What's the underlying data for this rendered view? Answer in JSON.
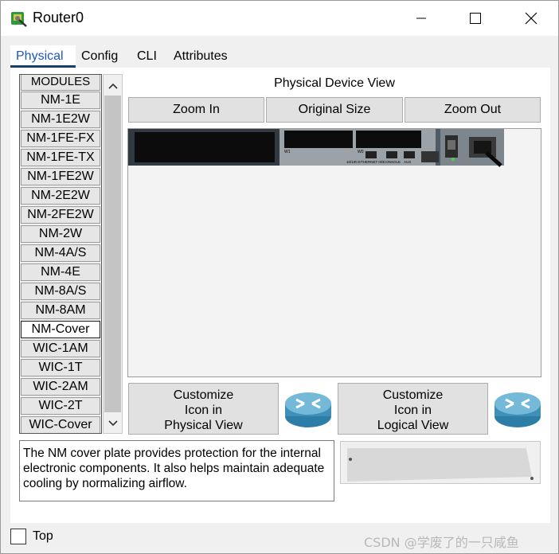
{
  "window": {
    "title": "Router0",
    "icon": "router-tool-icon"
  },
  "title_controls": {
    "minimize": "minimize-icon",
    "maximize": "maximize-icon",
    "close": "close-icon"
  },
  "tabs": [
    {
      "label": "Physical",
      "active": true
    },
    {
      "label": "Config",
      "active": false
    },
    {
      "label": "CLI",
      "active": false
    },
    {
      "label": "Attributes",
      "active": false
    }
  ],
  "modules": {
    "header": "MODULES",
    "items": [
      "NM-1E",
      "NM-1E2W",
      "NM-1FE-FX",
      "NM-1FE-TX",
      "NM-1FE2W",
      "NM-2E2W",
      "NM-2FE2W",
      "NM-2W",
      "NM-4A/S",
      "NM-4E",
      "NM-8A/S",
      "NM-8AM",
      "NM-Cover",
      "WIC-1AM",
      "WIC-1T",
      "WIC-2AM",
      "WIC-2T",
      "WIC-Cover"
    ],
    "selected": "NM-Cover"
  },
  "device_view": {
    "label": "Physical Device View",
    "zoom_in": "Zoom In",
    "original_size": "Original Size",
    "zoom_out": "Zoom Out",
    "port_labels": [
      "W1",
      "W0",
      "10/100",
      "ETHERNET 0/0",
      "CONSOLE",
      "AUX"
    ]
  },
  "customize": {
    "physical": [
      "Customize",
      "Icon in",
      "Physical View"
    ],
    "logical": [
      "Customize",
      "Icon in",
      "Logical View"
    ]
  },
  "description": "The NM cover plate provides protection for the internal electronic components. It also helps maintain adequate cooling by normalizing airflow.",
  "footer": {
    "top_checkbox_label": "Top",
    "top_checked": false,
    "watermark": "CSDN @学废了的一只咸鱼"
  },
  "colors": {
    "active_tab_text": "#1a55c0",
    "active_tab_underline": "#1a3f6e",
    "router_blue": "#3f8fb8"
  }
}
